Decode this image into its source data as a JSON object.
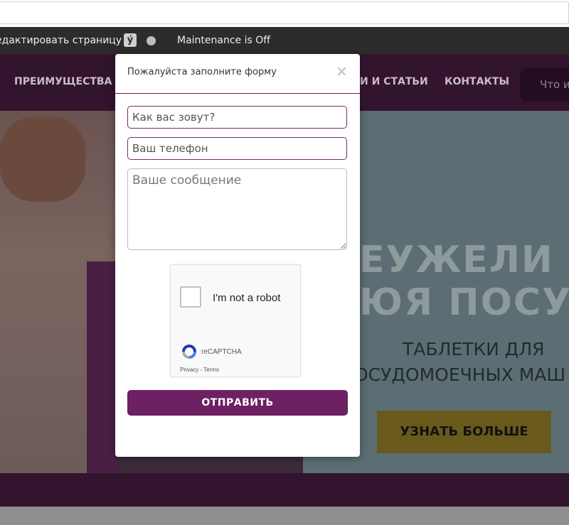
{
  "admin_bar": {
    "edit_label": "едактировать страницу",
    "yoast_glyph": "ý",
    "maintenance_label": "Maintenance is Off"
  },
  "nav": {
    "items": [
      "ПРЕИМУЩЕСТВА",
      "И И СТАТЬИ",
      "КОНТАКТЫ"
    ],
    "search_placeholder": "Что и"
  },
  "hero": {
    "headline_line1": "ЕУЖЕЛИ ЭТ",
    "headline_line2": "ЮЯ ПОСУД",
    "sub_line1": "ТАБЛЕТКИ ДЛЯ",
    "sub_line2": "ОСУДОМОЕЧНЫХ МАШ",
    "button_label": "УЗНАТЬ БОЛЬШЕ"
  },
  "modal": {
    "title": "Пожалуйста заполните форму",
    "close_glyph": "×",
    "name_placeholder": "Как вас зовут?",
    "phone_placeholder": "Ваш телефон",
    "message_placeholder": "Ваше сообщение",
    "submit_label": "ОТПРАВИТЬ"
  },
  "recaptcha": {
    "label": "I'm not a robot",
    "brand": "reCAPTCHA",
    "privacy": "Privacy - Terms"
  },
  "colors": {
    "accent": "#6d2062",
    "admin_bar": "#2c2c2c",
    "nav_bg": "#33142f"
  }
}
